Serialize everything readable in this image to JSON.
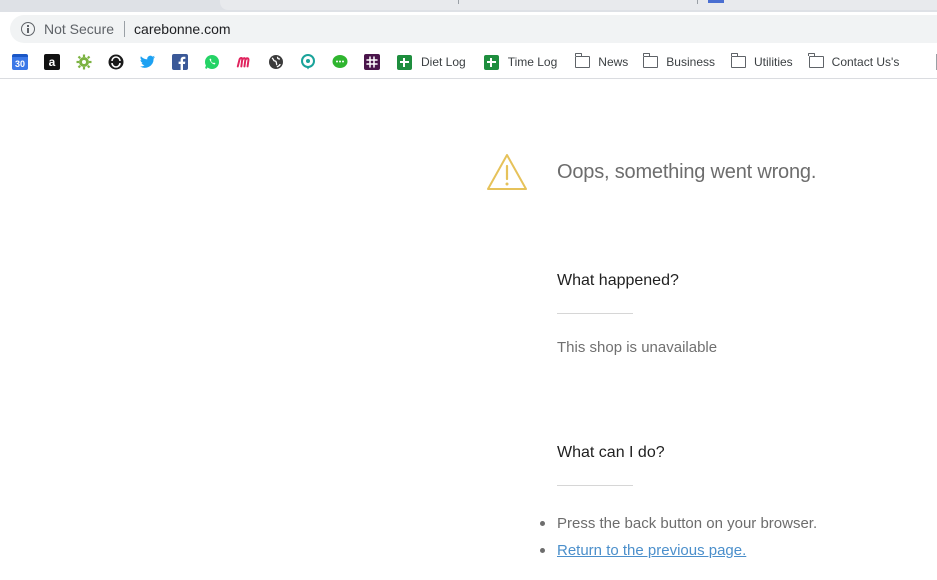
{
  "browser": {
    "security_label": "Not Secure",
    "url": "carebonne.com"
  },
  "bookmarks": {
    "calendar_date": "30",
    "amazon_letter": "a",
    "items": [
      {
        "label": "Diet Log",
        "icon": "sheets-icon"
      },
      {
        "label": "Time Log",
        "icon": "sheets-icon"
      },
      {
        "label": "News",
        "icon": "folder-icon"
      },
      {
        "label": "Business",
        "icon": "folder-icon"
      },
      {
        "label": "Utilities",
        "icon": "folder-icon"
      },
      {
        "label": "Contact Us's",
        "icon": "folder-icon"
      }
    ]
  },
  "error": {
    "title": "Oops, something went wrong.",
    "what_happened_heading": "What happened?",
    "what_happened_text": "This shop is unavailable",
    "what_can_i_do_heading": "What can I do?",
    "actions": [
      "Press the back button on your browser.",
      "Return to the previous page."
    ]
  },
  "colors": {
    "warning": "#e6c25a",
    "link": "#4b8fcb",
    "sheets_green": "#1e8e3e"
  }
}
